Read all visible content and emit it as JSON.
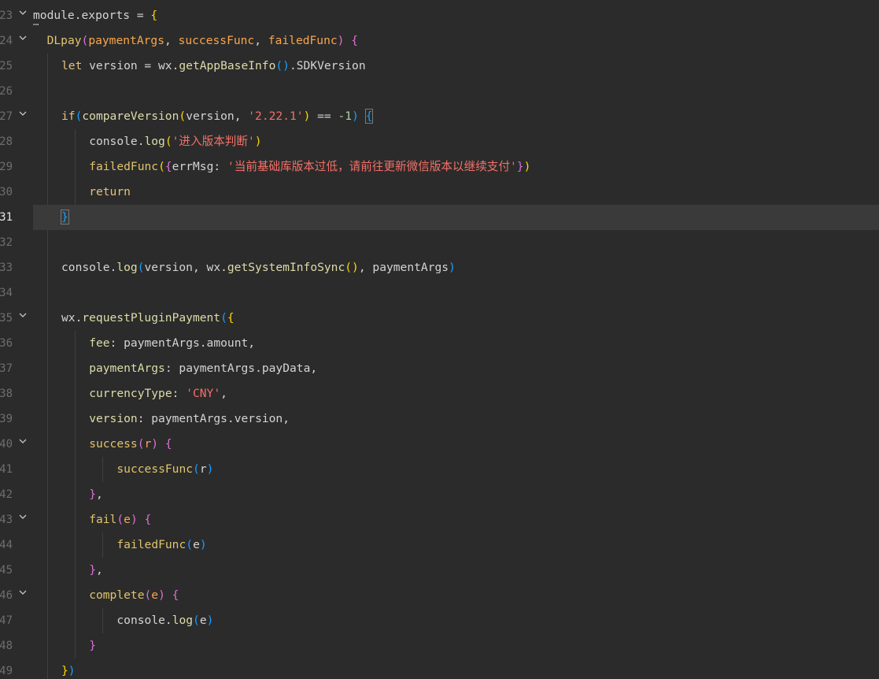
{
  "editor": {
    "lines": [
      {
        "num": "23",
        "fold": true,
        "indent": 0,
        "tokens": [
          {
            "t": "module",
            "c": "c-ident"
          },
          {
            "t": ".",
            "c": "c-punc"
          },
          {
            "t": "exports",
            "c": "c-ident"
          },
          {
            "t": " = ",
            "c": "c-punc"
          },
          {
            "t": "{",
            "c": "c-brace1"
          }
        ]
      },
      {
        "num": "24",
        "fold": true,
        "indent": 1,
        "tokens": [
          {
            "t": "DLpay",
            "c": "c-fn2"
          },
          {
            "t": "(",
            "c": "c-brace2"
          },
          {
            "t": "paymentArgs",
            "c": "c-param"
          },
          {
            "t": ", ",
            "c": "c-punc"
          },
          {
            "t": "successFunc",
            "c": "c-param"
          },
          {
            "t": ", ",
            "c": "c-punc"
          },
          {
            "t": "failedFunc",
            "c": "c-param"
          },
          {
            "t": ")",
            "c": "c-brace2"
          },
          {
            "t": " ",
            "c": "c-punc"
          },
          {
            "t": "{",
            "c": "c-brace2"
          }
        ]
      },
      {
        "num": "25",
        "fold": false,
        "indent": 2,
        "tokens": [
          {
            "t": "let",
            "c": "c-kw"
          },
          {
            "t": " version = wx.",
            "c": "c-ident"
          },
          {
            "t": "getAppBaseInfo",
            "c": "c-method"
          },
          {
            "t": "()",
            "c": "c-brace3"
          },
          {
            "t": ".SDKVersion",
            "c": "c-ident"
          }
        ]
      },
      {
        "num": "26",
        "fold": false,
        "indent": 2,
        "tokens": []
      },
      {
        "num": "27",
        "fold": true,
        "indent": 2,
        "tokens": [
          {
            "t": "if",
            "c": "c-kw"
          },
          {
            "t": "(",
            "c": "c-brace3"
          },
          {
            "t": "compareVersion",
            "c": "c-method"
          },
          {
            "t": "(",
            "c": "c-brace1"
          },
          {
            "t": "version, ",
            "c": "c-ident"
          },
          {
            "t": "'2.22.1'",
            "c": "c-str"
          },
          {
            "t": ")",
            "c": "c-brace1"
          },
          {
            "t": " == ",
            "c": "c-punc"
          },
          {
            "t": "-1",
            "c": "c-num"
          },
          {
            "t": ")",
            "c": "c-brace3"
          },
          {
            "t": " ",
            "c": "c-punc"
          },
          {
            "t": "{",
            "c": "c-brace3",
            "box": true
          }
        ]
      },
      {
        "num": "28",
        "fold": false,
        "indent": 3,
        "tokens": [
          {
            "t": "console.",
            "c": "c-ident"
          },
          {
            "t": "log",
            "c": "c-method"
          },
          {
            "t": "(",
            "c": "c-brace1"
          },
          {
            "t": "'进入版本判断'",
            "c": "c-str"
          },
          {
            "t": ")",
            "c": "c-brace1"
          }
        ]
      },
      {
        "num": "29",
        "fold": false,
        "indent": 3,
        "tokens": [
          {
            "t": "failedFunc",
            "c": "c-fn2"
          },
          {
            "t": "(",
            "c": "c-brace1"
          },
          {
            "t": "{",
            "c": "c-brace2"
          },
          {
            "t": "errMsg",
            "c": "c-ident"
          },
          {
            "t": ": ",
            "c": "c-punc"
          },
          {
            "t": "'当前基础库版本过低，请前往更新微信版本以继续支付'",
            "c": "c-str"
          },
          {
            "t": "}",
            "c": "c-brace2"
          },
          {
            "t": ")",
            "c": "c-brace1"
          }
        ]
      },
      {
        "num": "30",
        "fold": false,
        "indent": 3,
        "tokens": [
          {
            "t": "return",
            "c": "c-kw"
          }
        ]
      },
      {
        "num": "31",
        "fold": false,
        "indent": 2,
        "current": true,
        "tokens": [
          {
            "t": "}",
            "c": "c-brace3",
            "box": true
          }
        ]
      },
      {
        "num": "32",
        "fold": false,
        "indent": 2,
        "tokens": []
      },
      {
        "num": "33",
        "fold": false,
        "indent": 2,
        "tokens": [
          {
            "t": "console.",
            "c": "c-ident"
          },
          {
            "t": "log",
            "c": "c-method"
          },
          {
            "t": "(",
            "c": "c-brace3"
          },
          {
            "t": "version, wx.",
            "c": "c-ident"
          },
          {
            "t": "getSystemInfoSync",
            "c": "c-method"
          },
          {
            "t": "()",
            "c": "c-brace1"
          },
          {
            "t": ", paymentArgs",
            "c": "c-ident"
          },
          {
            "t": ")",
            "c": "c-brace3"
          }
        ]
      },
      {
        "num": "34",
        "fold": false,
        "indent": 2,
        "tokens": []
      },
      {
        "num": "35",
        "fold": true,
        "indent": 2,
        "tokens": [
          {
            "t": "wx.",
            "c": "c-ident"
          },
          {
            "t": "requestPluginPayment",
            "c": "c-method"
          },
          {
            "t": "(",
            "c": "c-brace3"
          },
          {
            "t": "{",
            "c": "c-brace1"
          }
        ]
      },
      {
        "num": "36",
        "fold": false,
        "indent": 3,
        "tokens": [
          {
            "t": "fee",
            "c": "c-key"
          },
          {
            "t": ": paymentArgs.amount,",
            "c": "c-ident"
          }
        ]
      },
      {
        "num": "37",
        "fold": false,
        "indent": 3,
        "tokens": [
          {
            "t": "paymentArgs",
            "c": "c-key"
          },
          {
            "t": ": paymentArgs.payData,",
            "c": "c-ident"
          }
        ]
      },
      {
        "num": "38",
        "fold": false,
        "indent": 3,
        "tokens": [
          {
            "t": "currencyType",
            "c": "c-key"
          },
          {
            "t": ": ",
            "c": "c-ident"
          },
          {
            "t": "'CNY'",
            "c": "c-str"
          },
          {
            "t": ",",
            "c": "c-ident"
          }
        ]
      },
      {
        "num": "39",
        "fold": false,
        "indent": 3,
        "tokens": [
          {
            "t": "version",
            "c": "c-key"
          },
          {
            "t": ": paymentArgs.version,",
            "c": "c-ident"
          }
        ]
      },
      {
        "num": "40",
        "fold": true,
        "indent": 3,
        "tokens": [
          {
            "t": "success",
            "c": "c-fn2"
          },
          {
            "t": "(",
            "c": "c-brace2"
          },
          {
            "t": "r",
            "c": "c-param"
          },
          {
            "t": ")",
            "c": "c-brace2"
          },
          {
            "t": " ",
            "c": "c-punc"
          },
          {
            "t": "{",
            "c": "c-brace2"
          }
        ]
      },
      {
        "num": "41",
        "fold": false,
        "indent": 4,
        "tokens": [
          {
            "t": "successFunc",
            "c": "c-fn2"
          },
          {
            "t": "(",
            "c": "c-brace3"
          },
          {
            "t": "r",
            "c": "c-ident"
          },
          {
            "t": ")",
            "c": "c-brace3"
          }
        ]
      },
      {
        "num": "42",
        "fold": false,
        "indent": 3,
        "tokens": [
          {
            "t": "}",
            "c": "c-brace2"
          },
          {
            "t": ",",
            "c": "c-ident"
          }
        ]
      },
      {
        "num": "43",
        "fold": true,
        "indent": 3,
        "tokens": [
          {
            "t": "fail",
            "c": "c-fn2"
          },
          {
            "t": "(",
            "c": "c-brace2"
          },
          {
            "t": "e",
            "c": "c-param"
          },
          {
            "t": ")",
            "c": "c-brace2"
          },
          {
            "t": " ",
            "c": "c-punc"
          },
          {
            "t": "{",
            "c": "c-brace2"
          }
        ]
      },
      {
        "num": "44",
        "fold": false,
        "indent": 4,
        "tokens": [
          {
            "t": "failedFunc",
            "c": "c-fn2"
          },
          {
            "t": "(",
            "c": "c-brace3"
          },
          {
            "t": "e",
            "c": "c-ident"
          },
          {
            "t": ")",
            "c": "c-brace3"
          }
        ]
      },
      {
        "num": "45",
        "fold": false,
        "indent": 3,
        "tokens": [
          {
            "t": "}",
            "c": "c-brace2"
          },
          {
            "t": ",",
            "c": "c-ident"
          }
        ]
      },
      {
        "num": "46",
        "fold": true,
        "indent": 3,
        "tokens": [
          {
            "t": "complete",
            "c": "c-fn2"
          },
          {
            "t": "(",
            "c": "c-brace2"
          },
          {
            "t": "e",
            "c": "c-param"
          },
          {
            "t": ")",
            "c": "c-brace2"
          },
          {
            "t": " ",
            "c": "c-punc"
          },
          {
            "t": "{",
            "c": "c-brace2"
          }
        ]
      },
      {
        "num": "47",
        "fold": false,
        "indent": 4,
        "tokens": [
          {
            "t": "console.",
            "c": "c-ident"
          },
          {
            "t": "log",
            "c": "c-method"
          },
          {
            "t": "(",
            "c": "c-brace3"
          },
          {
            "t": "e",
            "c": "c-ident"
          },
          {
            "t": ")",
            "c": "c-brace3"
          }
        ]
      },
      {
        "num": "48",
        "fold": false,
        "indent": 3,
        "tokens": [
          {
            "t": "}",
            "c": "c-brace2"
          }
        ]
      },
      {
        "num": "49",
        "fold": false,
        "indent": 2,
        "tokens": [
          {
            "t": "}",
            "c": "c-brace1"
          },
          {
            "t": ")",
            "c": "c-brace3"
          }
        ]
      }
    ],
    "fold_ellipsis": "⋯"
  }
}
